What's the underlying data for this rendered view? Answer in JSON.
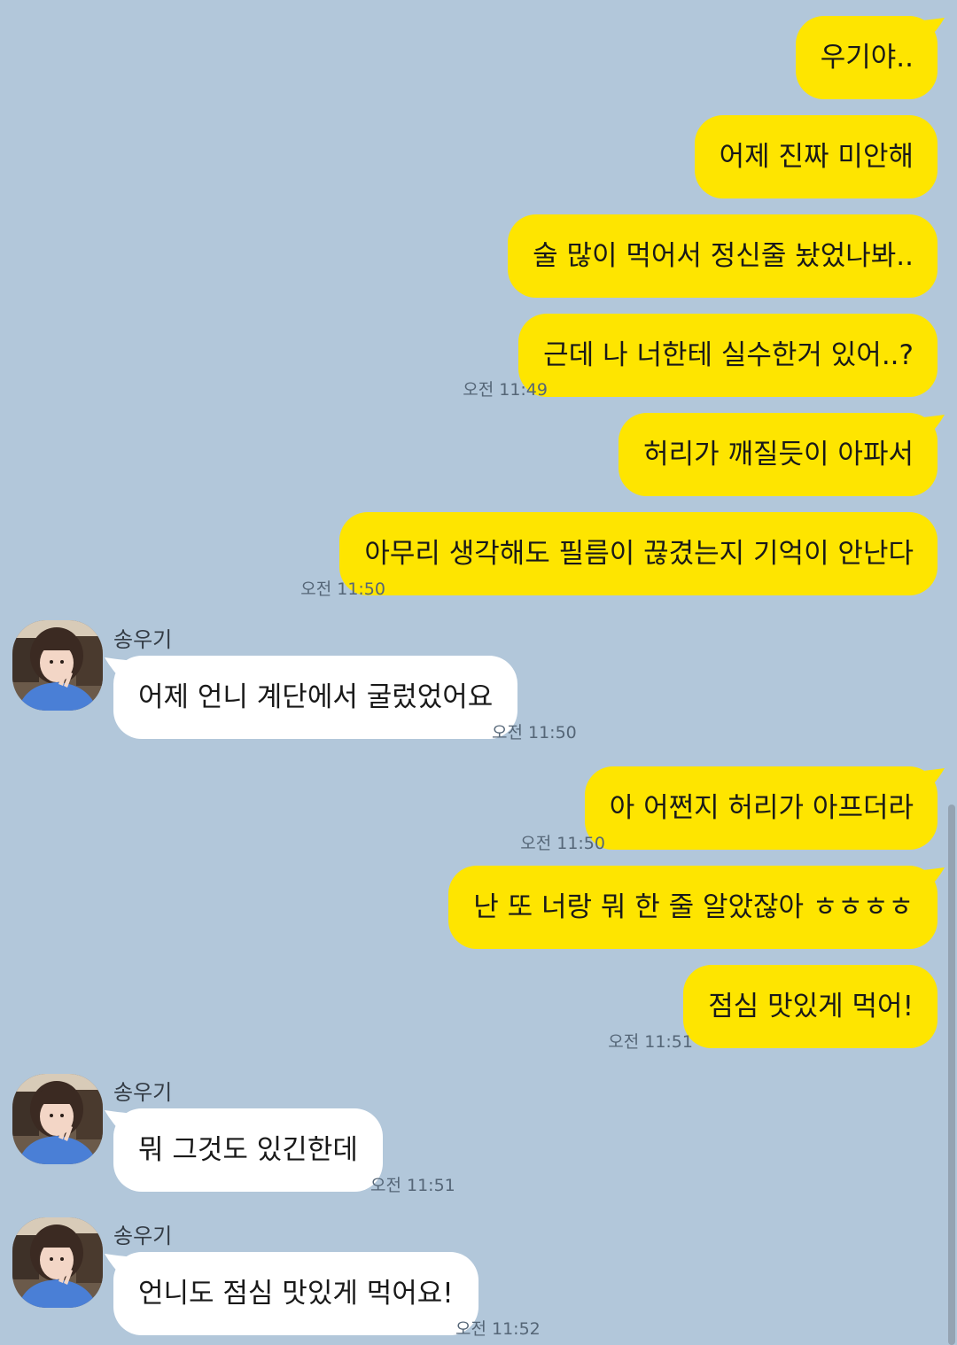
{
  "contact": {
    "name": "송우기"
  },
  "messages": [
    {
      "text": "우기야..",
      "time": ""
    },
    {
      "text": "어제 진짜 미안해",
      "time": ""
    },
    {
      "text": "술 많이 먹어서 정신줄 놨었나봐..",
      "time": ""
    },
    {
      "text": "근데 나 너한테 실수한거 있어..?",
      "time": "오전 11:49"
    },
    {
      "text": "허리가 깨질듯이 아파서",
      "time": ""
    },
    {
      "text": "아무리 생각해도 필름이 끊겼는지 기억이 안난다",
      "time": "오전 11:50"
    },
    {
      "text": "어제 언니 계단에서 굴렀었어요",
      "time": "오전 11:50"
    },
    {
      "text": "아 어쩐지 허리가 아프더라",
      "time": "오전 11:50"
    },
    {
      "text": "난 또 너랑 뭐 한 줄 알았잖아 ㅎㅎㅎㅎ",
      "time": ""
    },
    {
      "text": "점심 맛있게 먹어!",
      "time": "오전 11:51"
    },
    {
      "text": "뭐 그것도 있긴한데",
      "time": "오전 11:51"
    },
    {
      "text": "언니도 점심 맛있게 먹어요!",
      "time": "오전 11:52"
    }
  ],
  "colors": {
    "background": "#b2c7da",
    "my_bubble": "#fee500",
    "their_bubble": "#ffffff"
  },
  "icons": {
    "avatar": "profile-photo"
  }
}
